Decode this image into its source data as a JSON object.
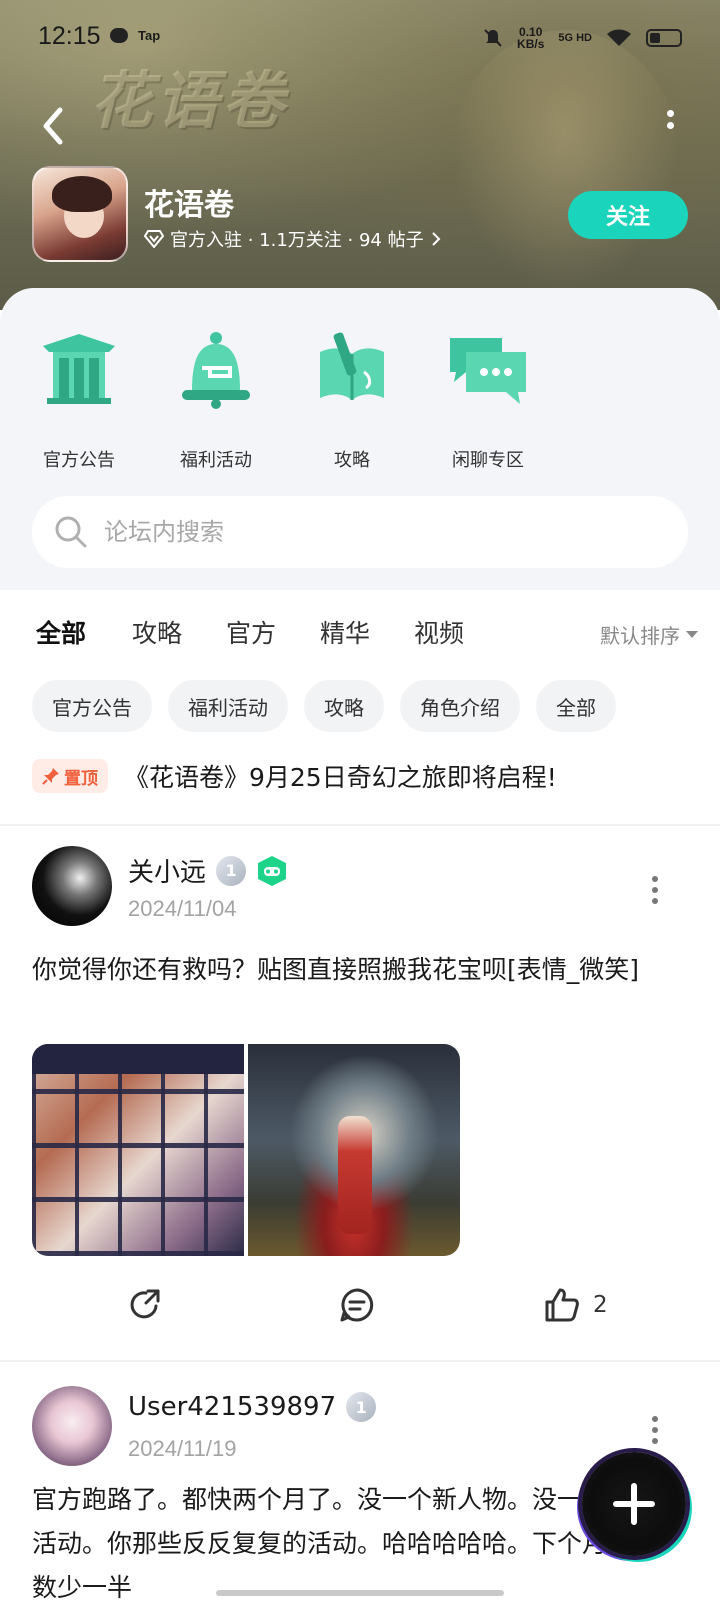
{
  "status_bar": {
    "time": "12:15",
    "app_label": "Tap",
    "speed_value": "0.10",
    "speed_unit": "KB/s",
    "network": "5G HD"
  },
  "forum": {
    "name": "花语卷",
    "banner_logo": "花语卷",
    "meta": "官方入驻 · 1.1万关注 · 94 帖子",
    "follow_label": "关注"
  },
  "shortcuts": [
    {
      "label": "官方公告",
      "icon": "pavilion-icon"
    },
    {
      "label": "福利活动",
      "icon": "bell-icon"
    },
    {
      "label": "攻略",
      "icon": "book-sword-icon"
    },
    {
      "label": "闲聊专区",
      "icon": "chat-bubbles-icon"
    }
  ],
  "search": {
    "placeholder": "论坛内搜索"
  },
  "tabs": {
    "items": [
      "全部",
      "攻略",
      "官方",
      "精华",
      "视频"
    ],
    "active": "全部",
    "sort_label": "默认排序"
  },
  "chips": [
    "官方公告",
    "福利活动",
    "攻略",
    "角色介绍",
    "全部"
  ],
  "pinned": {
    "badge": "置顶",
    "title": "《花语卷》9月25日奇幻之旅即将启程!"
  },
  "posts": [
    {
      "username": "关小远",
      "level": "1",
      "date": "2024/11/04",
      "text": "你觉得你还有救吗？贴图直接照搬我花宝呗[表情_微笑]",
      "likes": "2"
    },
    {
      "username": "User421539897",
      "level": "1",
      "date": "2024/11/19",
      "text": "官方跑路了。都快两个月了。没一个新人物。没一个新活动。你那些反反复复的活动。哈哈哈哈哈。下个月人数少一半"
    }
  ],
  "colors": {
    "accent": "#1ad4bb",
    "pin_red": "#f0603c",
    "panel_bg": "#f3f5f8"
  }
}
